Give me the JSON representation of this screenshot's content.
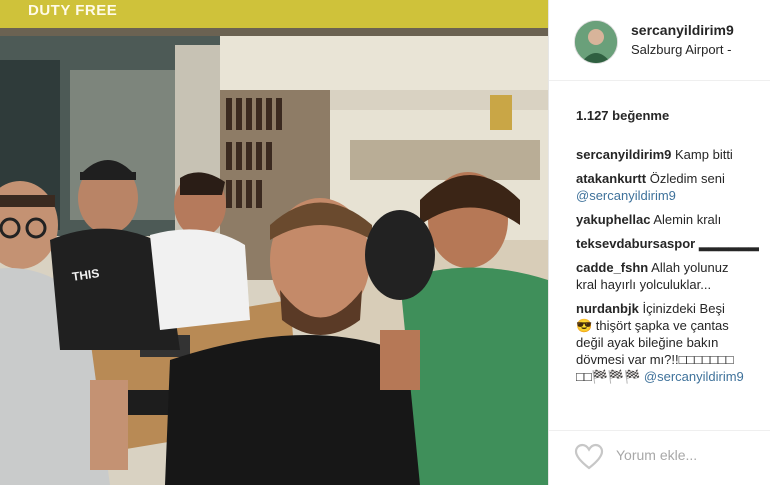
{
  "photo": {
    "store_sign": "DUTY FREE",
    "shirt_text_line1": "THIS",
    "shirt_text_line2": "..."
  },
  "post": {
    "username": "sercanyildirim9",
    "location": "Salzburg Airport - ",
    "likes": "1.127 beğenme"
  },
  "comments": [
    {
      "user": "sercanyildirim9",
      "lines": [
        "Kamp bitti"
      ]
    },
    {
      "user": "atakankurtt",
      "lines": [
        "Özledim seni"
      ],
      "mention": "@sercanyildirim9"
    },
    {
      "user": "yakuphellac",
      "lines": [
        "Alemin kralı"
      ]
    },
    {
      "user": "teksevdabursaspor",
      "lines": [
        "▂▂▂▂▂▂"
      ]
    },
    {
      "user": "cadde_fshn",
      "lines": [
        "Allah yolunuz",
        "kral hayırlı yolculuklar..."
      ]
    },
    {
      "user": "nurdanbjk",
      "lines": [
        "İçinizdeki Beşi",
        "😎 thişört şapka ve çantas",
        "değil ayak bileğine bakın",
        "dövmesi var mı?!!□□□□□□□"
      ],
      "last_prefix": "□□🏁🏁🏁",
      "mention": "@sercanyildirim9"
    }
  ],
  "footer": {
    "placeholder": "Yorum ekle...",
    "heart_icon": "heart-outline-icon"
  },
  "colors": {
    "mention": "#3f729b",
    "text": "#262626",
    "muted": "#a8a8a8",
    "duty_free_banner": "#cfc23a",
    "green_shirt": "#3f8f5a"
  }
}
